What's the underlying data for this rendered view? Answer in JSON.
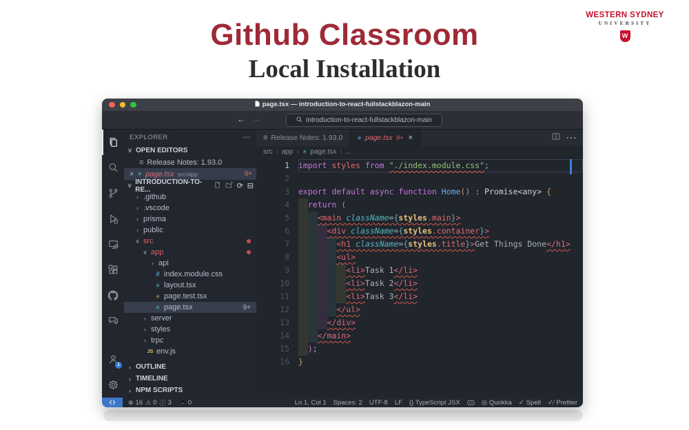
{
  "slide": {
    "title": "Github Classroom",
    "subtitle": "Local Installation"
  },
  "logo": {
    "line1": "WESTERN SYDNEY",
    "line2": "UNIVERSITY",
    "shield_letter": "W"
  },
  "icons": {
    "chevron_down": "∨",
    "chevron_right": "›",
    "menu_dots": "⋯",
    "list": "≡",
    "close": "×",
    "react": "✳",
    "hash": "#",
    "js": "JS",
    "refresh": "⟳",
    "collapse": "⊟",
    "quokka": "◎",
    "check": "✓",
    "prettier_check": "✓∕",
    "error": "⊗",
    "warning": "⚠",
    "info": "ⓘ",
    "back": "←",
    "forward": "→"
  },
  "window": {
    "title": "page.tsx — introduction-to-react-fullstackblazon-main",
    "search": "introduction-to-react-fullstackblazon-main"
  },
  "activity_bar": {
    "icons": [
      "explorer",
      "search",
      "source-control",
      "run-debug",
      "remote-explorer",
      "extensions",
      "github",
      "comments",
      "accounts",
      "settings"
    ],
    "account_badge": "1"
  },
  "sidebar": {
    "header": "EXPLORER",
    "open_editors_label": "OPEN EDITORS",
    "open_editors": [
      {
        "label": "Release Notes: 1.93.0"
      },
      {
        "label": "page.tsx",
        "detail": "src/app",
        "badge": "9+",
        "selected": true
      }
    ],
    "project_label": "INTRODUCTION-TO-RE...",
    "tree": [
      {
        "indent": 1,
        "arrow": "right",
        "label": ".github"
      },
      {
        "indent": 1,
        "arrow": "right",
        "label": ".vscode"
      },
      {
        "indent": 1,
        "arrow": "right",
        "label": "prisma"
      },
      {
        "indent": 1,
        "arrow": "right",
        "label": "public"
      },
      {
        "indent": 1,
        "arrow": "down",
        "label": "src",
        "mod": true,
        "dot": true
      },
      {
        "indent": 2,
        "arrow": "down",
        "label": "app",
        "mod": true,
        "dot": true
      },
      {
        "indent": 3,
        "arrow": "right",
        "label": "api"
      },
      {
        "indent": 3,
        "icon": "hash",
        "label": "index.module.css"
      },
      {
        "indent": 3,
        "icon": "react",
        "label": "layout.tsx"
      },
      {
        "indent": 3,
        "icon": "react-orange",
        "label": "page.test.tsx"
      },
      {
        "indent": 3,
        "icon": "react",
        "label": "page.tsx",
        "selected": true,
        "badge": "9+"
      },
      {
        "indent": 2,
        "arrow": "right",
        "label": "server"
      },
      {
        "indent": 2,
        "arrow": "right",
        "label": "styles"
      },
      {
        "indent": 2,
        "arrow": "right",
        "label": "trpc"
      },
      {
        "indent": 2,
        "icon": "js",
        "label": "env.js"
      }
    ],
    "sections": [
      "OUTLINE",
      "TIMELINE",
      "NPM SCRIPTS"
    ]
  },
  "editor": {
    "tabs": [
      {
        "label": "Release Notes: 1.93.0",
        "active": false
      },
      {
        "label": "page.tsx",
        "badge": "9+",
        "active": true
      }
    ],
    "breadcrumb": {
      "a": "src",
      "b": "app",
      "c": "page.tsx",
      "d": "..."
    },
    "code": [
      {
        "n": 1,
        "i": 0,
        "cur": true,
        "t": [
          [
            "kw",
            "import "
          ],
          [
            "var",
            "styles "
          ],
          [
            "kw",
            "from "
          ],
          [
            "str",
            "\"./index.module.css\"",
            1
          ],
          [
            "pun",
            ";"
          ]
        ]
      },
      {
        "n": 2,
        "i": 0,
        "t": []
      },
      {
        "n": 3,
        "i": 0,
        "t": [
          [
            "kw",
            "export default async function "
          ],
          [
            "fn",
            "Home"
          ],
          [
            "par",
            "()"
          ],
          [
            "pun",
            " : "
          ],
          [
            "type",
            "Promise<any>"
          ],
          [
            "pun",
            " "
          ],
          [
            "obr",
            "{"
          ]
        ]
      },
      {
        "n": 4,
        "i": 1,
        "t": [
          [
            "kw",
            "return "
          ],
          [
            "ppar",
            "("
          ]
        ]
      },
      {
        "n": 5,
        "i": 2,
        "t": [
          [
            "tag",
            "<main ",
            1
          ],
          [
            "attr",
            "className",
            1
          ],
          [
            "pun",
            "=",
            1
          ],
          [
            "brc",
            "{",
            1
          ],
          [
            "obj",
            "styles",
            1
          ],
          [
            "prop",
            ".main",
            1
          ],
          [
            "brc",
            "}",
            1
          ],
          [
            "tag",
            ">",
            1
          ]
        ]
      },
      {
        "n": 6,
        "i": 3,
        "t": [
          [
            "tag",
            "<div ",
            1
          ],
          [
            "attr",
            "className",
            1
          ],
          [
            "pun",
            "=",
            1
          ],
          [
            "brc",
            "{",
            1
          ],
          [
            "obj",
            "styles",
            1
          ],
          [
            "prop",
            ".container",
            1
          ],
          [
            "brc",
            "}",
            1
          ],
          [
            "tag",
            ">",
            1
          ]
        ]
      },
      {
        "n": 7,
        "i": 4,
        "t": [
          [
            "tag",
            "<h1 ",
            1
          ],
          [
            "attr",
            "className",
            1
          ],
          [
            "pun",
            "=",
            1
          ],
          [
            "brc",
            "{",
            1
          ],
          [
            "obj",
            "styles",
            1
          ],
          [
            "prop",
            ".title",
            1
          ],
          [
            "brc",
            "}",
            1
          ],
          [
            "tag",
            ">",
            1
          ],
          [
            "txt",
            "Get Things Done"
          ],
          [
            "tag",
            "</h1>",
            1
          ]
        ]
      },
      {
        "n": 8,
        "i": 4,
        "t": [
          [
            "tag",
            "<ul>",
            1
          ]
        ]
      },
      {
        "n": 9,
        "i": 5,
        "t": [
          [
            "tag",
            "<li>",
            1
          ],
          [
            "txt",
            "Task 1"
          ],
          [
            "tag",
            "</li>",
            1
          ]
        ]
      },
      {
        "n": 10,
        "i": 5,
        "t": [
          [
            "tag",
            "<li>",
            1
          ],
          [
            "txt",
            "Task 2"
          ],
          [
            "tag",
            "</li>",
            1
          ]
        ]
      },
      {
        "n": 11,
        "i": 5,
        "t": [
          [
            "tag",
            "<li>",
            1
          ],
          [
            "txt",
            "Task 3"
          ],
          [
            "tag",
            "</li>",
            1
          ]
        ]
      },
      {
        "n": 12,
        "i": 4,
        "t": [
          [
            "tag",
            "</ul>",
            1
          ]
        ]
      },
      {
        "n": 13,
        "i": 3,
        "t": [
          [
            "tag",
            "</div>",
            1
          ]
        ]
      },
      {
        "n": 14,
        "i": 2,
        "t": [
          [
            "tag",
            "</main>",
            1
          ]
        ]
      },
      {
        "n": 15,
        "i": 1,
        "t": [
          [
            "ppar",
            ")"
          ],
          [
            "pun",
            ";"
          ]
        ]
      },
      {
        "n": 16,
        "i": 0,
        "t": [
          [
            "obr",
            "}"
          ]
        ]
      }
    ]
  },
  "status_bar": {
    "errors": "16",
    "warnings": "0",
    "infos": "3",
    "ports": "0",
    "line_col": "Ln 1, Col 1",
    "spaces": "Spaces: 2",
    "encoding": "UTF-8",
    "eol": "LF",
    "language": "{} TypeScript JSX",
    "quokka": "Quokka",
    "spell": "Spell",
    "prettier": "Prettier"
  }
}
